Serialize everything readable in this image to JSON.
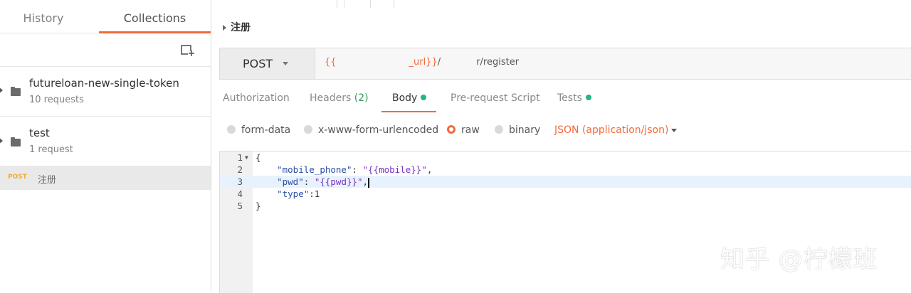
{
  "sidebar": {
    "tabs": {
      "history": "History",
      "collections": "Collections"
    },
    "new_collection_icon": "new-folder-icon",
    "collections": [
      {
        "name": "futureloan-new-single-token",
        "count": "10 requests"
      },
      {
        "name": "test",
        "count": "1 request"
      }
    ],
    "request": {
      "method": "POST",
      "name": "注册"
    }
  },
  "main": {
    "request_title": "注册",
    "method": "POST",
    "url": {
      "open": "{{",
      "var_tail": "_url}}",
      "mid": "/",
      "path_end": "r/register"
    },
    "tabs": [
      {
        "label": "Authorization"
      },
      {
        "label": "Headers",
        "count": "(2)"
      },
      {
        "label": "Body"
      },
      {
        "label": "Pre-request Script"
      },
      {
        "label": "Tests"
      }
    ],
    "body_types": [
      "form-data",
      "x-www-form-urlencoded",
      "raw",
      "binary"
    ],
    "selected_body_type": "raw",
    "format": "JSON (application/json)",
    "editor_lines": [
      "1",
      "2",
      "3",
      "4",
      "5"
    ],
    "code": {
      "l1": "{",
      "l2_key": "\"mobile_phone\"",
      "l2_sep": ": ",
      "l2_val": "\"{{mobile}}\"",
      "l2_end": ",",
      "l3_key": "\"pwd\"",
      "l3_sep": ": ",
      "l3_val": "\"{{pwd}}\"",
      "l3_end": ",",
      "l4_key": "\"type\"",
      "l4_rest": ":1",
      "l5": "}"
    }
  },
  "watermark": "知乎 @柠檬班",
  "colors": {
    "accent": "#f26b3a",
    "dot": "#26b47f",
    "post": "#f2a93b"
  }
}
